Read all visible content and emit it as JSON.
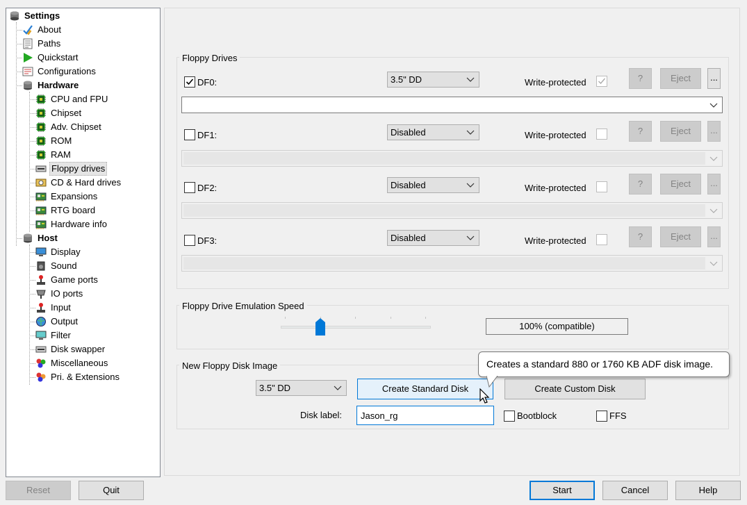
{
  "tree": {
    "root": "Settings",
    "items": [
      {
        "label": "About"
      },
      {
        "label": "Paths"
      },
      {
        "label": "Quickstart"
      },
      {
        "label": "Configurations"
      },
      {
        "label": "Hardware"
      },
      {
        "label": "CPU and FPU"
      },
      {
        "label": "Chipset"
      },
      {
        "label": "Adv. Chipset"
      },
      {
        "label": "ROM"
      },
      {
        "label": "RAM"
      },
      {
        "label": "Floppy drives"
      },
      {
        "label": "CD & Hard drives"
      },
      {
        "label": "Expansions"
      },
      {
        "label": "RTG board"
      },
      {
        "label": "Hardware info"
      },
      {
        "label": "Host"
      },
      {
        "label": "Display"
      },
      {
        "label": "Sound"
      },
      {
        "label": "Game ports"
      },
      {
        "label": "IO ports"
      },
      {
        "label": "Input"
      },
      {
        "label": "Output"
      },
      {
        "label": "Filter"
      },
      {
        "label": "Disk swapper"
      },
      {
        "label": "Miscellaneous"
      },
      {
        "label": "Pri. & Extensions"
      }
    ],
    "selected": "Floppy drives"
  },
  "floppy_drives": {
    "title": "Floppy Drives",
    "write_protected_label": "Write-protected",
    "info_label": "?",
    "eject_label": "Eject",
    "browse_label": "...",
    "drives": [
      {
        "name": "DF0:",
        "enabled": true,
        "type": "3.5\" DD",
        "write_protected": true,
        "path": ""
      },
      {
        "name": "DF1:",
        "enabled": false,
        "type": "Disabled",
        "write_protected": false,
        "path": ""
      },
      {
        "name": "DF2:",
        "enabled": false,
        "type": "Disabled",
        "write_protected": false,
        "path": ""
      },
      {
        "name": "DF3:",
        "enabled": false,
        "type": "Disabled",
        "write_protected": false,
        "path": ""
      }
    ]
  },
  "emulation_speed": {
    "title": "Floppy Drive Emulation Speed",
    "value_text": "100% (compatible)",
    "slider_level": 1,
    "slider_max": 4
  },
  "new_disk": {
    "title": "New Floppy Disk Image",
    "type": "3.5\" DD",
    "create_standard_label": "Create Standard Disk",
    "create_custom_label": "Create Custom Disk",
    "disk_label_caption": "Disk label:",
    "disk_label_value": "Jason_rg",
    "bootblock_label": "Bootblock",
    "ffs_label": "FFS",
    "bootblock_checked": false,
    "ffs_checked": false
  },
  "tooltip": {
    "text": "Creates a standard 880 or 1760 KB ADF disk image."
  },
  "footer": {
    "reset_label": "Reset",
    "quit_label": "Quit",
    "start_label": "Start",
    "cancel_label": "Cancel",
    "help_label": "Help"
  },
  "colors": {
    "accent": "#0078d7",
    "checkmark": "#000000",
    "quickstart_green": "#22a822"
  }
}
